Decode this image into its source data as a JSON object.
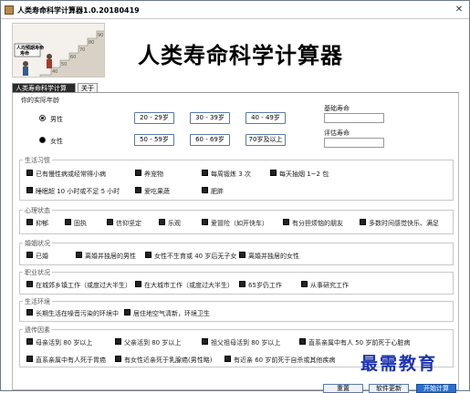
{
  "window": {
    "title": "人类寿命科学计算器1.0.20180419",
    "close": "✕"
  },
  "header": {
    "app_title": "人类寿命科学计算器",
    "banner_text": "人均预期寿命"
  },
  "tabs": [
    {
      "label": "人类寿命科学计算器"
    },
    {
      "label": "关于"
    }
  ],
  "age_section": {
    "label": "你的实际年龄",
    "gender": [
      {
        "label": "男性"
      },
      {
        "label": "女性"
      }
    ],
    "age_buttons": [
      "20 - 29岁",
      "30 - 39岁",
      "40 - 49岁",
      "50 - 59岁",
      "60 - 69岁",
      "70岁及以上"
    ],
    "base_life_label": "基础寿命",
    "eval_life_label": "评估寿命"
  },
  "groups": [
    {
      "legend": "生活习惯",
      "items": [
        "已有慢性病或经常得小病",
        "养宠物",
        "每周锻炼 3 次",
        "每天抽烟 1~2 包",
        "睡眠超 10 小时或不足 5 小时",
        "爱吃果蔬",
        "肥胖"
      ]
    },
    {
      "legend": "心理状态",
      "items": [
        "抑郁",
        "固执",
        "信仰坚定",
        "乐观",
        "爱冒险（如开快车）",
        "有分担烦恼的朋友",
        "多数时间感觉快乐、满足"
      ]
    },
    {
      "legend": "婚姻状况",
      "items": [
        "已婚",
        "离婚并独居的男性",
        "女性不生育或 40 岁后无子女",
        "离婚并独居的女性"
      ]
    },
    {
      "legend": "职业状况",
      "items": [
        "在城郊乡镇工作（或度过大半生）",
        "在大城市工作（或度过大半生）",
        "65岁仍工作",
        "从事研究工作"
      ]
    },
    {
      "legend": "生活环境",
      "items": [
        "长期生活在噪音污染的环境中",
        "居住地空气清新，环境卫生"
      ]
    },
    {
      "legend": "遗传因素",
      "items": [
        "母亲活到 80 岁以上",
        "父亲活到 80 岁以上",
        "祖父祖母活到 80 岁以上",
        "直系亲属中有人 50 岁前死于心脏病",
        "直系亲属中有人死于胃癌",
        "有女性近亲死于乳腺癌(男性略)",
        "有近亲 60 岁前死于自杀或其他疾病"
      ]
    }
  ],
  "buttons": {
    "reset": "重置",
    "recalc": "软件更新",
    "calc": "开始计算"
  },
  "watermark": "最需教育"
}
